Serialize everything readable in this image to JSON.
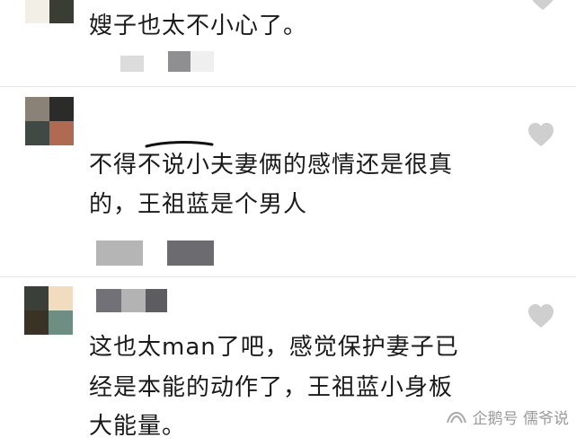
{
  "comments": [
    {
      "text_lines": [
        "嫂子也太不小心了。"
      ]
    },
    {
      "text_lines": [
        "不得不说小夫妻俩的感情还是很真",
        "的，王祖蓝是个男人"
      ]
    },
    {
      "text_lines": [
        "这也太man了吧，感觉保护妻子已",
        "经是本能的动作了，王祖蓝小身板",
        "大能量。"
      ]
    }
  ],
  "watermark": {
    "text": "企鹅号 儒爷说",
    "icon": "tencent-penguin-logo-icon"
  },
  "like_icon": "heart-icon",
  "colors": {
    "heart": "#cfcfcf",
    "text": "#1a1a1a",
    "divider": "#e6e6e6",
    "watermark": "#9a9a9a"
  }
}
